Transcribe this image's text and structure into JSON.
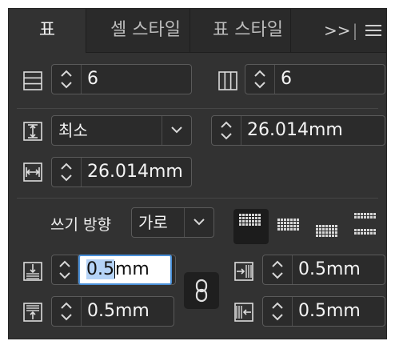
{
  "tabs": [
    {
      "label": "표",
      "active": true
    },
    {
      "label": "셀 스타일",
      "active": false
    },
    {
      "label": "표 스타일",
      "active": false
    }
  ],
  "tabbar": {
    "overflow_label": ">>",
    "divider": "|"
  },
  "rows": {
    "value": "6"
  },
  "columns": {
    "value": "6"
  },
  "row_height": {
    "mode": "최소",
    "value": "26.014mm"
  },
  "column_width": {
    "value": "26.014mm"
  },
  "writing_direction": {
    "label": "쓰기 방향",
    "value": "가로"
  },
  "insets": {
    "top": {
      "selected": "0.5",
      "rest": "mm"
    },
    "bottom": {
      "value": "0.5mm"
    },
    "left": {
      "value": "0.5mm"
    },
    "right": {
      "value": "0.5mm"
    }
  },
  "icons": {
    "rows": "table-rows-icon",
    "columns": "table-columns-icon",
    "row_height": "row-height-icon",
    "column_width": "column-width-icon",
    "link": "chain-link-icon",
    "menu": "hamburger-menu-icon"
  },
  "colors": {
    "panel_bg": "#323232",
    "tabbar_bg": "#2a2a2a",
    "focus_border": "#4a90d9",
    "selection": "#b5d3f7"
  }
}
